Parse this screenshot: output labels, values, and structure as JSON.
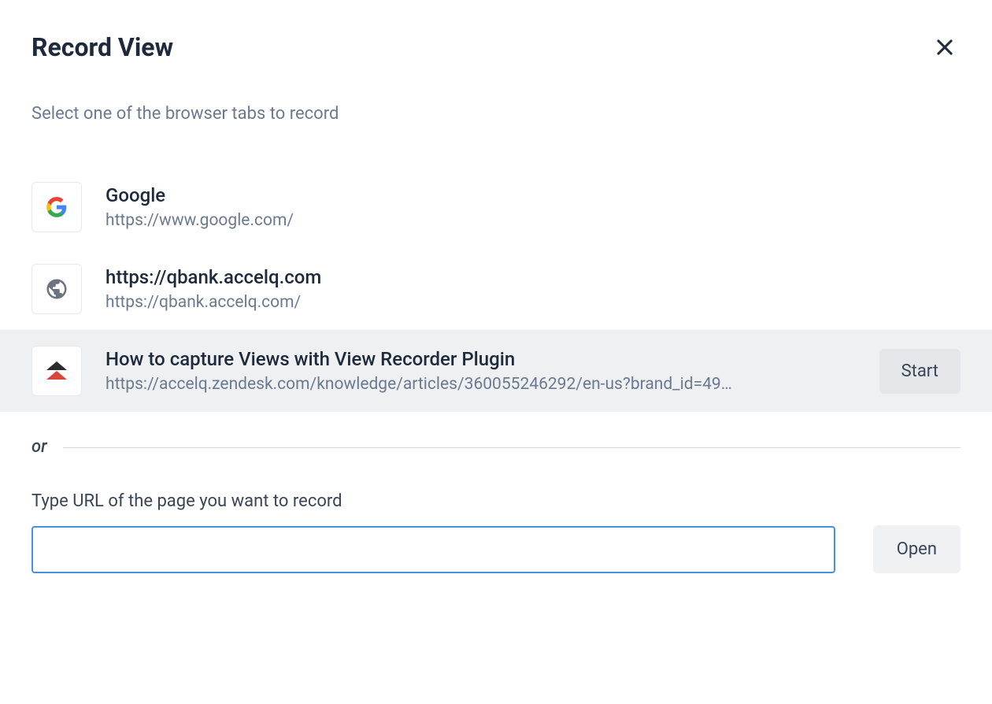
{
  "header": {
    "title": "Record View"
  },
  "subtitle": "Select one of the browser tabs to record",
  "tabs": [
    {
      "icon": "google",
      "title": "Google",
      "url": "https://www.google.com/",
      "selected": false
    },
    {
      "icon": "globe",
      "title": "https://qbank.accelq.com",
      "url": "https://qbank.accelq.com/",
      "selected": false
    },
    {
      "icon": "accelq",
      "title": "How to capture Views with View Recorder Plugin",
      "url": "https://accelq.zendesk.com/knowledge/articles/360055246292/en-us?brand_id=49…",
      "selected": true
    }
  ],
  "start_label": "Start",
  "divider": {
    "or_label": "or"
  },
  "url_section": {
    "label": "Type URL of the page you want to record",
    "value": "",
    "open_label": "Open"
  }
}
